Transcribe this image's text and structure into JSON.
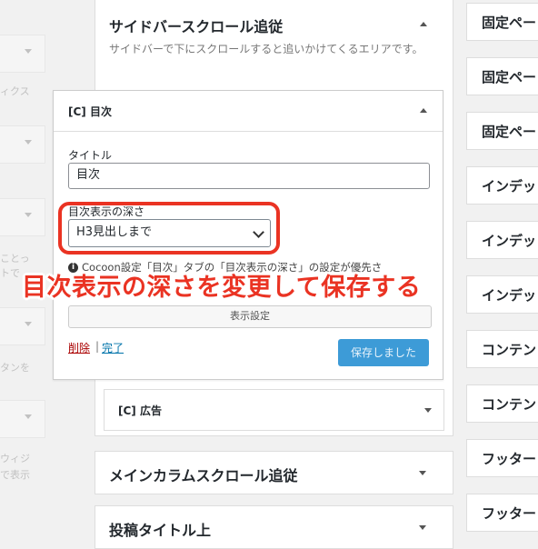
{
  "left_column": {
    "fragments": [
      "ィクス",
      "ことっ",
      "トで",
      "タンを",
      "ウィジ",
      "で表示"
    ]
  },
  "right_column": {
    "items": [
      "固定ペー",
      "固定ペー",
      "固定ペー",
      "インデッ",
      "インデッ",
      "インデッ",
      "コンテン",
      "コンテン",
      "フッター",
      "フッター"
    ]
  },
  "sidebar_scroll_panel": {
    "title": "サイドバースクロール追従",
    "description": "サイドバーで下にスクロールすると追いかけてくるエリアです。"
  },
  "toc_widget": {
    "title": "[C] 目次",
    "title_field_label": "タイトル",
    "title_field_value": "目次",
    "depth_label": "目次表示の深さ",
    "depth_value": "H3見出しまで",
    "notice": "Cocoon設定「目次」タブの「目次表示の深さ」の設定が優先さ",
    "settings_button": "表示設定",
    "delete_link": "削除",
    "separator": "|",
    "done_link": "完了",
    "save_button": "保存しました"
  },
  "ad_widget": {
    "title": "[C] 広告"
  },
  "main_column_panel": {
    "title": "メインカラムスクロール追従"
  },
  "post_title_panel": {
    "title": "投稿タイトル上"
  },
  "annotation": {
    "text": "目次表示の深さを変更して保存する",
    "color": "#ea3323"
  },
  "colors": {
    "primary_button": "#3d9bd7",
    "delete_link": "#aa0000",
    "done_link": "#0073aa"
  }
}
